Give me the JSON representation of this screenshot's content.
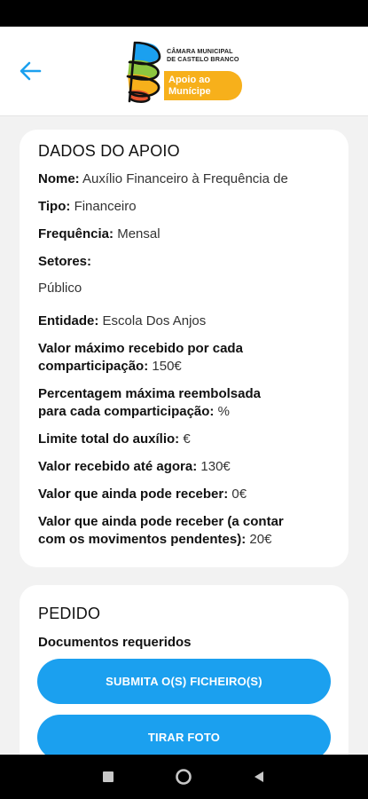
{
  "header": {
    "logo_line1": "Câmara Municipal",
    "logo_line2": "de Castelo Branco",
    "logo_pill_line1": "Apoio ao",
    "logo_pill_line2": "Munícipe",
    "brand_color": "#f7b01b"
  },
  "apoio": {
    "title": "DADOS DO APOIO",
    "nome_label": "Nome:",
    "nome_value": "Auxílio Financeiro à Frequência de",
    "tipo_label": "Tipo:",
    "tipo_value": "Financeiro",
    "frequencia_label": "Frequência:",
    "frequencia_value": "Mensal",
    "setores_label": "Setores:",
    "setores_value": "Público",
    "entidade_label": "Entidade:",
    "entidade_value": "Escola Dos Anjos",
    "valor_max_label_1": "Valor máximo recebido por cada",
    "valor_max_label_2": "comparticipação:",
    "valor_max_value": "150€",
    "percent_label_1": "Percentagem máxima reembolsada",
    "percent_label_2": "para cada comparticipação:",
    "percent_value": "%",
    "limite_label": "Limite total do auxílio:",
    "limite_value": "€",
    "recebido_label": "Valor recebido até agora:",
    "recebido_value": "130€",
    "pode_receber_label": "Valor que ainda pode receber:",
    "pode_receber_value": "0€",
    "pendentes_label_1": "Valor que ainda pode receber (a contar",
    "pendentes_label_2": "com os movimentos pendentes):",
    "pendentes_value": "20€"
  },
  "pedido": {
    "title": "PEDIDO",
    "docs_label": "Documentos requeridos",
    "submit_button": "SUBMITA O(S) FICHEIRO(S)",
    "photo_button": "TIRAR FOTO",
    "button_color": "#1ba0ef"
  },
  "nav": {
    "icons": [
      "recents-square-icon",
      "home-circle-icon",
      "back-triangle-icon"
    ]
  }
}
